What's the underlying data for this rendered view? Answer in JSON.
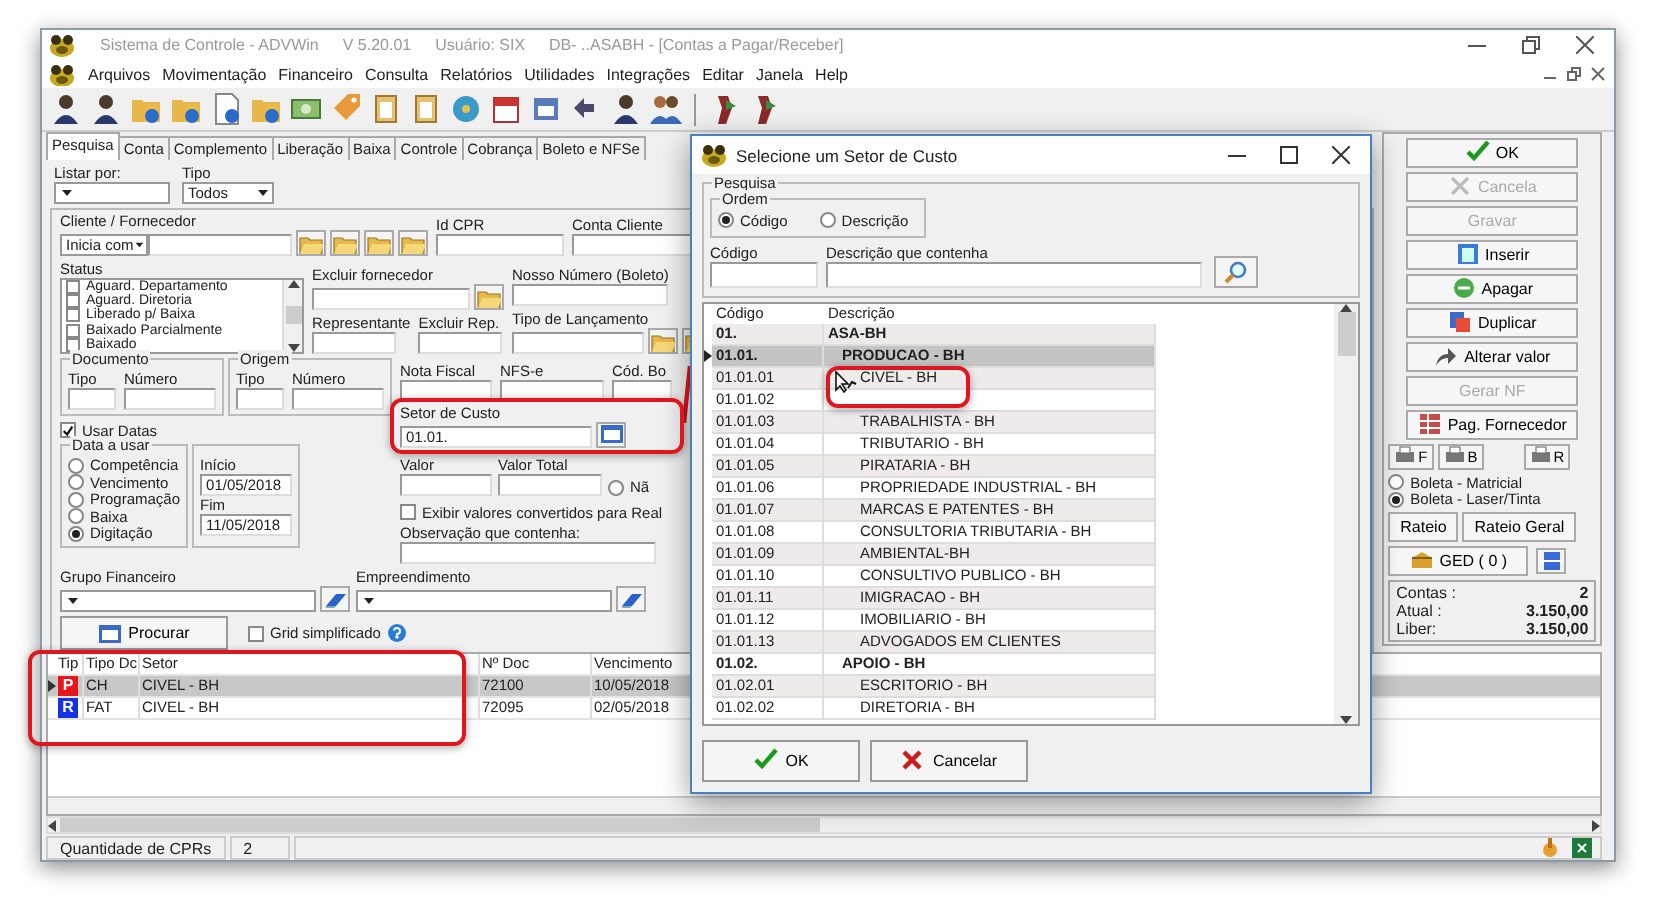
{
  "window": {
    "title": "Sistema de Controle - ADVWin",
    "version": "V 5.20.01",
    "user": "Usuário: SIX",
    "database": "DB- ..ASABH - [Contas a Pagar/Receber]"
  },
  "menu": [
    "Arquivos",
    "Movimentação",
    "Financeiro",
    "Consulta",
    "Relatórios",
    "Utilidades",
    "Integrações",
    "Editar",
    "Janela",
    "Help"
  ],
  "tabs": [
    {
      "label": "Pesquisa",
      "selected": true
    },
    {
      "label": "Conta",
      "selected": false
    },
    {
      "label": "Complemento",
      "selected": false
    },
    {
      "label": "Liberação",
      "selected": false
    },
    {
      "label": "Baixa",
      "selected": false
    },
    {
      "label": "Controle",
      "selected": false
    },
    {
      "label": "Cobrança",
      "selected": false
    },
    {
      "label": "Boleto e NFSe",
      "selected": false
    }
  ],
  "search_form": {
    "listar_por": {
      "label": "Listar por:"
    },
    "tipo": {
      "label": "Tipo",
      "value": "Todos"
    },
    "cliente": {
      "label": "Cliente / Fornecedor",
      "mode": "Inicia com"
    },
    "id_cpr": {
      "label": "Id CPR"
    },
    "conta_cliente": {
      "label": "Conta Cliente"
    },
    "status": {
      "label": "Status",
      "items": [
        {
          "label": "Aguard. Departamento",
          "checked": false
        },
        {
          "label": "Aguard. Diretoria",
          "checked": false
        },
        {
          "label": "Liberado p/ Baixa",
          "checked": false
        },
        {
          "label": "Baixado Parcialmente",
          "checked": false
        },
        {
          "label": "Baixado",
          "checked": false
        }
      ]
    },
    "excluir_fornecedor": {
      "label": "Excluir fornecedor"
    },
    "nosso_numero": {
      "label": "Nosso Número (Boleto)"
    },
    "representante": {
      "label": "Representante"
    },
    "excluir_rep": {
      "label": "Excluir Rep."
    },
    "tipo_lancamento": {
      "label": "Tipo de Lançamento"
    },
    "documento": {
      "title": "Documento",
      "fields": [
        "Tipo",
        "Número"
      ]
    },
    "origem": {
      "title": "Origem",
      "fields": [
        "Tipo",
        "Número"
      ]
    },
    "nota_fiscal": {
      "label": "Nota Fiscal"
    },
    "nfse": {
      "label": "NFS-e"
    },
    "cod_bol": {
      "label": "Cód. Bo"
    },
    "usar_datas": {
      "label": "Usar Datas",
      "checked": true
    },
    "setor_custo": {
      "label": "Setor de Custo",
      "value": "01.01."
    },
    "valor": {
      "label": "Valor"
    },
    "valor_total": {
      "label": "Valor Total"
    },
    "partial_option": {
      "label": "Nã",
      "selected": false
    },
    "data_a_usar": {
      "title": "Data a usar",
      "options": [
        {
          "label": "Competência",
          "selected": false
        },
        {
          "label": "Vencimento",
          "selected": false
        },
        {
          "label": "Programação",
          "selected": false
        },
        {
          "label": "Baixa",
          "selected": false
        },
        {
          "label": "Digitação",
          "selected": true
        }
      ]
    },
    "inicio": {
      "label": "Início",
      "value": "01/05/2018"
    },
    "fim": {
      "label": "Fim",
      "value": "11/05/2018"
    },
    "exibir_convertidos": {
      "label": "Exibir valores convertidos para Real",
      "checked": false
    },
    "observacao": {
      "label": "Observação que contenha:"
    },
    "grupo_financeiro": {
      "label": "Grupo Financeiro"
    },
    "empreendimento": {
      "label": "Empreendimento"
    },
    "procurar": {
      "label": "Procurar"
    },
    "grid_simplificado": {
      "label": "Grid simplificado",
      "checked": false
    }
  },
  "actions": [
    {
      "label": "OK",
      "disabled": false
    },
    {
      "label": "Cancela",
      "disabled": true
    },
    {
      "label": "Gravar",
      "disabled": true
    },
    {
      "label": "Inserir",
      "disabled": false
    },
    {
      "label": "Apagar",
      "disabled": false
    },
    {
      "label": "Duplicar",
      "disabled": false
    },
    {
      "label": "Alterar valor",
      "disabled": false
    },
    {
      "label": "Gerar NF",
      "disabled": true
    },
    {
      "label": "Pag. Fornecedor",
      "disabled": false
    }
  ],
  "print_buttons": [
    "F",
    "B",
    "R"
  ],
  "boleta_options": [
    {
      "label": "Boleta - Matricial",
      "selected": false
    },
    {
      "label": "Boleta - Laser/Tinta",
      "selected": true
    }
  ],
  "rateio_buttons": [
    "Rateio",
    "Rateio Geral"
  ],
  "ged": {
    "label": "GED ( 0 )"
  },
  "totals": [
    {
      "label": "Contas :",
      "value": "2"
    },
    {
      "label": "Atual :",
      "value": "3.150,00"
    },
    {
      "label": "Liber:",
      "value": "3.150,00"
    }
  ],
  "grid": {
    "columns": [
      "Tip",
      "Tipo Dc",
      "Setor",
      "Nº Doc",
      "Vencimento"
    ],
    "rows": [
      {
        "tip": "P",
        "color": "#e8141c",
        "tipo_dc": "CH",
        "setor": "CIVEL - BH",
        "n_doc": "72100",
        "vencimento": "10/05/2018",
        "selected": true
      },
      {
        "tip": "R",
        "color": "#1432e6",
        "tipo_dc": "FAT",
        "setor": "CIVEL - BH",
        "n_doc": "72095",
        "vencimento": "02/05/2018",
        "selected": false
      }
    ]
  },
  "status_bar": {
    "label": "Quantidade de CPRs",
    "count": "2"
  },
  "dialog": {
    "title": "Selecione um Setor de Custo",
    "group": "Pesquisa",
    "order_group": "Ordem",
    "order_options": [
      {
        "label": "Código",
        "selected": true
      },
      {
        "label": "Descrição",
        "selected": false
      }
    ],
    "code_label": "Código",
    "description_label": "Descrição que contenha",
    "columns": [
      "Código",
      "Descrição"
    ],
    "rows": [
      {
        "code": "01.",
        "description": "ASA-BH",
        "selected": false,
        "children": [
          {
            "code": "01.01.",
            "description": "PRODUCAO - BH",
            "selected": true,
            "children": [
              {
                "code": "01.01.01",
                "description": "CIVEL - BH",
                "selected": false
              },
              {
                "code": "01.01.02",
                "selected": false
              },
              {
                "code": "01.01.03",
                "description": "TRABALHISTA - BH",
                "selected": false
              },
              {
                "code": "01.01.04",
                "description": "TRIBUTARIO - BH",
                "selected": false
              },
              {
                "code": "01.01.05",
                "description": "PIRATARIA - BH",
                "selected": false
              },
              {
                "code": "01.01.06",
                "description": "PROPRIEDADE INDUSTRIAL - BH",
                "selected": false
              },
              {
                "code": "01.01.07",
                "description": "MARCAS E PATENTES - BH",
                "selected": false
              },
              {
                "code": "01.01.08",
                "description": "CONSULTORIA TRIBUTARIA - BH",
                "selected": false
              },
              {
                "code": "01.01.09",
                "description": "AMBIENTAL-BH",
                "selected": false
              },
              {
                "code": "01.01.10",
                "description": "CONSULTIVO PUBLICO - BH",
                "selected": false
              },
              {
                "code": "01.01.11",
                "description": "IMIGRACAO - BH",
                "selected": false
              },
              {
                "code": "01.01.12",
                "description": "IMOBILIARIO - BH",
                "selected": false
              },
              {
                "code": "01.01.13",
                "description": "ADVOGADOS EM CLIENTES",
                "selected": false
              }
            ]
          },
          {
            "code": "01.02.",
            "description": "APOIO - BH",
            "selected": false,
            "children": [
              {
                "code": "01.02.01",
                "description": "ESCRITORIO - BH",
                "selected": false
              },
              {
                "code": "01.02.02",
                "description": "DIRETORIA - BH",
                "selected": false
              }
            ]
          }
        ]
      }
    ],
    "buttons": [
      "OK",
      "Cancelar"
    ]
  }
}
